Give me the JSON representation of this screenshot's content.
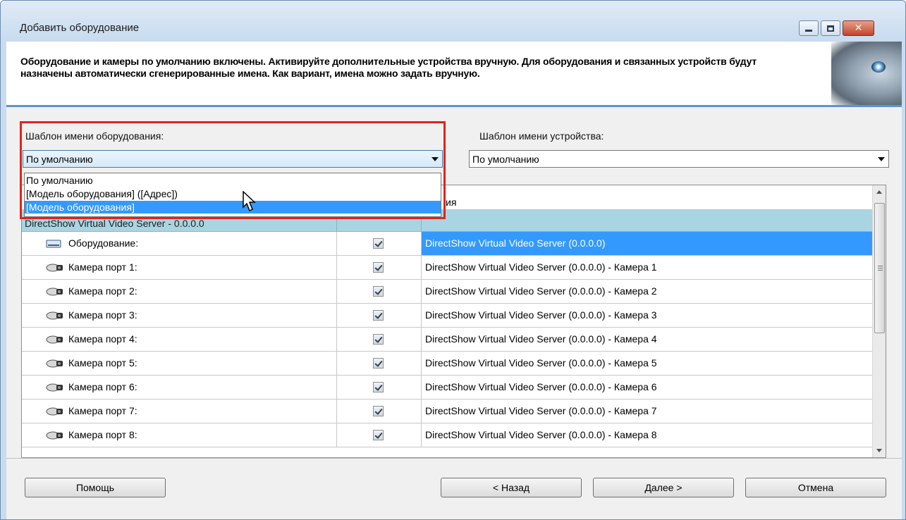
{
  "window": {
    "title": "Добавить оборудование",
    "buttons": {
      "minimize": "minimize-icon",
      "maximize": "maximize-icon",
      "close": "close-icon"
    }
  },
  "header": {
    "text": "Оборудование и камеры по умолчанию включены. Активируйте дополнительные устройства вручную. Для оборудования и связанных устройств будут назначены автоматически сгенерированные имена. Как вариант, имена можно задать вручную.",
    "logo": "wolf-eye-logo"
  },
  "hardware_template": {
    "label": "Шаблон имени оборудования:",
    "value": "По умолчанию",
    "options": [
      "По умолчанию",
      "[Модель оборудования] ([Адрес])",
      "[Модель оборудования]"
    ],
    "selected_index": 2
  },
  "device_template": {
    "label": "Шаблон имени устройства:",
    "value": "По умолчанию"
  },
  "grid": {
    "column_name_fragment": "ия",
    "group": "DirectShow Virtual Video Server - 0.0.0.0",
    "rows": [
      {
        "label": "Оборудование:",
        "icon": "hardware-icon",
        "checked": true,
        "name": "DirectShow Virtual Video Server (0.0.0.0)",
        "selected": true
      },
      {
        "label": "Камера порт 1:",
        "icon": "camera-icon",
        "checked": true,
        "name": "DirectShow Virtual Video Server (0.0.0.0) - Камера 1"
      },
      {
        "label": "Камера порт 2:",
        "icon": "camera-icon",
        "checked": true,
        "name": "DirectShow Virtual Video Server (0.0.0.0) - Камера 2"
      },
      {
        "label": "Камера порт 3:",
        "icon": "camera-icon",
        "checked": true,
        "name": "DirectShow Virtual Video Server (0.0.0.0) - Камера 3"
      },
      {
        "label": "Камера порт 4:",
        "icon": "camera-icon",
        "checked": true,
        "name": "DirectShow Virtual Video Server (0.0.0.0) - Камера 4"
      },
      {
        "label": "Камера порт 5:",
        "icon": "camera-icon",
        "checked": true,
        "name": "DirectShow Virtual Video Server (0.0.0.0) - Камера 5"
      },
      {
        "label": "Камера порт 6:",
        "icon": "camera-icon",
        "checked": true,
        "name": "DirectShow Virtual Video Server (0.0.0.0) - Камера 6"
      },
      {
        "label": "Камера порт 7:",
        "icon": "camera-icon",
        "checked": true,
        "name": "DirectShow Virtual Video Server (0.0.0.0) - Камера 7"
      },
      {
        "label": "Камера порт 8:",
        "icon": "camera-icon",
        "checked": true,
        "name": "DirectShow Virtual Video Server (0.0.0.0) - Камера 8"
      }
    ]
  },
  "footer": {
    "help": "Помощь",
    "back": "< Назад",
    "next": "Далее >",
    "cancel": "Отмена"
  },
  "colors": {
    "selection": "#3399ff",
    "group_row": "#a9d4e2",
    "highlight": "#e2231a",
    "header_separator": "#5d93cf"
  }
}
